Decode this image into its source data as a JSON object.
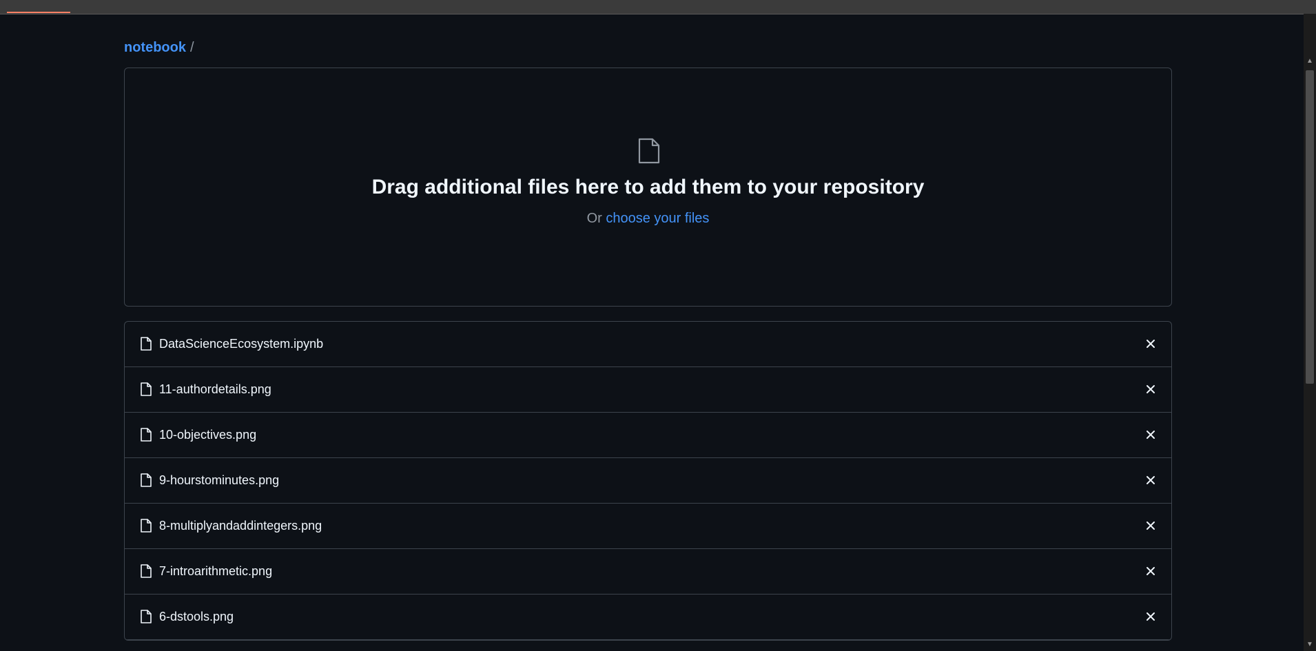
{
  "breadcrumb": {
    "repo": "notebook",
    "separator": "/"
  },
  "dropzone": {
    "icon": "file-icon",
    "headline": "Drag additional files here to add them to your repository",
    "prefix": "Or",
    "choose_link": "choose your files"
  },
  "files": [
    {
      "name": "DataScienceEcosystem.ipynb",
      "icon": "file-icon"
    },
    {
      "name": "11-authordetails.png",
      "icon": "file-icon"
    },
    {
      "name": "10-objectives.png",
      "icon": "file-icon"
    },
    {
      "name": "9-hourstominutes.png",
      "icon": "file-icon"
    },
    {
      "name": "8-multiplyandaddintegers.png",
      "icon": "file-icon"
    },
    {
      "name": "7-introarithmetic.png",
      "icon": "file-icon"
    },
    {
      "name": "6-dstools.png",
      "icon": "file-icon"
    }
  ],
  "colors": {
    "background": "#0d1117",
    "link": "#4493f8",
    "border": "#3d444d",
    "text": "#f0f6fc",
    "muted": "#9198a1"
  }
}
